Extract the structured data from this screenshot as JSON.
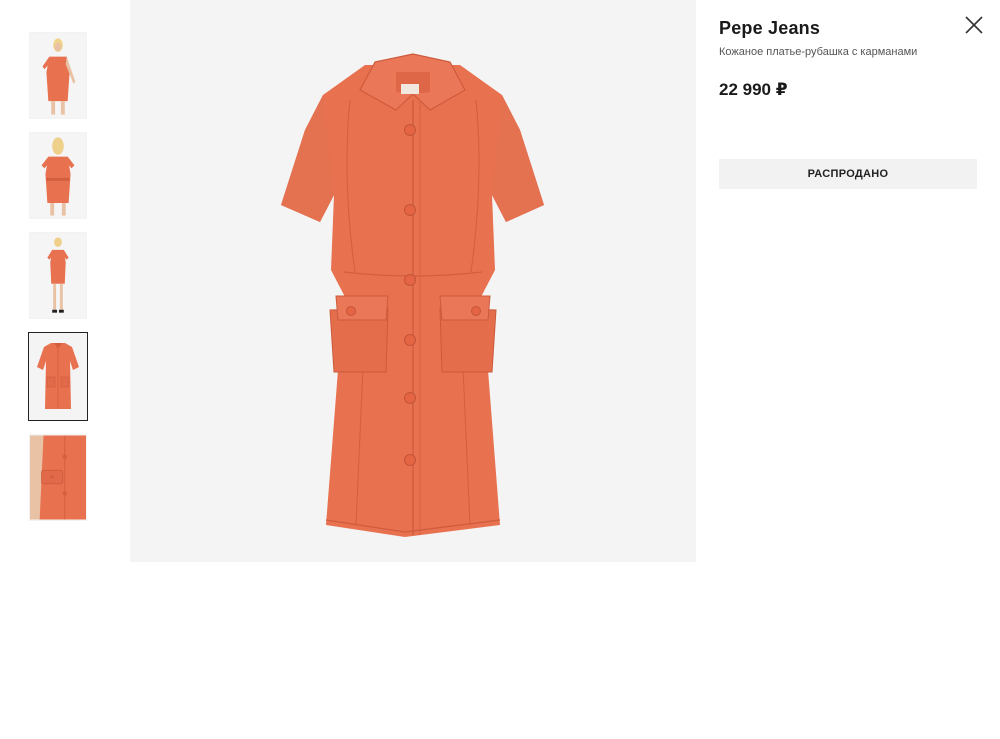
{
  "product": {
    "brand": "Pepe Jeans",
    "subtitle": "Кожаное платье-рубашка с карманами",
    "price": "22 990 ₽",
    "status_button": "РАСПРОДАНО"
  },
  "gallery": {
    "thumbnails": [
      {
        "view": "model-front"
      },
      {
        "view": "model-back"
      },
      {
        "view": "model-full"
      },
      {
        "view": "product-flat",
        "selected": true
      },
      {
        "view": "detail-closeup"
      }
    ],
    "main_view": "product-flat"
  },
  "colors": {
    "dress": "#e8714f",
    "dress_shadow": "#d25f3f",
    "background": "#f4f4f4",
    "button_bg": "#f2f2f2"
  },
  "icons": {
    "close": "close-icon"
  }
}
